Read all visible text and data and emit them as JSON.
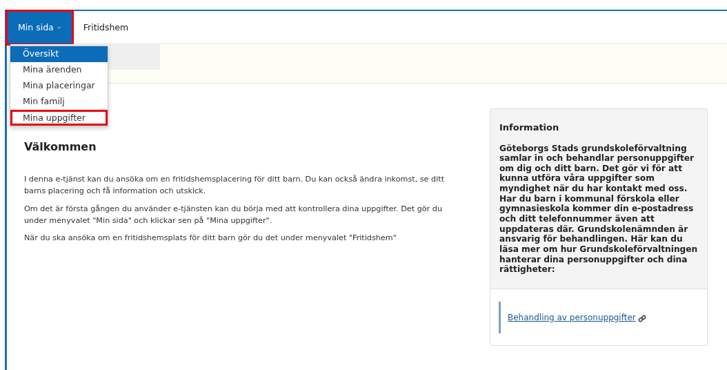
{
  "nav": [
    {
      "label": "Min sida",
      "selected": true,
      "highlighted": true,
      "dropdown": true
    },
    {
      "label": "Fritidshem",
      "selected": false,
      "highlighted": false,
      "dropdown": false
    }
  ],
  "menu": [
    {
      "label": "Översikt",
      "selected": true,
      "highlighted": false
    },
    {
      "label": "Mina ärenden",
      "selected": false,
      "highlighted": false
    },
    {
      "label": "Mina placeringar",
      "selected": false,
      "highlighted": false
    },
    {
      "label": "Min familj",
      "selected": false,
      "highlighted": false
    },
    {
      "label": "Mina uppgifter",
      "selected": false,
      "highlighted": true
    }
  ],
  "heading": "Välkommen",
  "paragraphs": [
    "I denna e-tjänst kan du ansöka om en fritidshemsplacering för ditt barn. Du kan också ändra inkomst, se ditt barns placering och få information och utskick.",
    "Om det är första gången du använder e-tjänsten kan du börja med att kontrollera dina uppgifter. Det gör du under menyvalet \"Min sida\" och klickar sen på \"Mina uppgifter\".",
    "När du ska ansöka om en fritidshemsplats för ditt barn gör du det under menyvalet \"Fritidshem\""
  ],
  "info": {
    "title": "Information",
    "body": "Göteborgs Stads grundskoleförvaltning samlar in och behandlar personuppgifter om dig och ditt barn. Det gör vi för att kunna utföra våra uppgifter som myndighet när du har kontakt med oss. Har du barn i kommunal förskola eller gymnasieskola kommer din e-postadress och ditt telefonnummer även att uppdateras där. Grundskolenämnden är ansvarig för behandlingen. Här kan du läsa mer om hur Grundskoleförvaltningen hanterar dina personuppgifter och dina rättigheter:",
    "link": "Behandling av personuppgifter"
  }
}
